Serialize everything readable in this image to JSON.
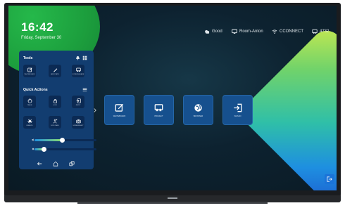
{
  "home": {
    "time": "16:42",
    "date": "Friday, September 30"
  },
  "status_bar": {
    "weather": "Good",
    "room": "Room-Anton",
    "connect": "CCONNECT",
    "code": "4732"
  },
  "sidebar": {
    "tools_title": "Tools",
    "tools": [
      {
        "label": "WHITEBOARD",
        "icon": "whiteboard-icon"
      },
      {
        "label": "ANNOTATE",
        "icon": "pen-icon"
      },
      {
        "label": "SCREENSHARE",
        "icon": "screenshare-icon"
      }
    ],
    "quick_title": "Quick Actions",
    "quick_actions": [
      {
        "label": "TIMER",
        "icon": "timer-icon"
      },
      {
        "label": "LOCK",
        "icon": "lock-icon"
      },
      {
        "label": "INPUT",
        "icon": "input-icon"
      },
      {
        "label": "FREEZE",
        "icon": "freeze-icon"
      },
      {
        "label": "EYE CARE",
        "icon": "eye-care-icon"
      },
      {
        "label": "SCREENSHOT",
        "icon": "camera-icon"
      }
    ],
    "volume_level": 0.45,
    "brightness_level": 0.15
  },
  "apps": [
    {
      "label": "WHITEBOARD",
      "icon": "whiteboard-icon"
    },
    {
      "label": "PROJECT",
      "icon": "project-icon"
    },
    {
      "label": "BROWSER",
      "icon": "globe-icon"
    },
    {
      "label": "SIGN-IN",
      "icon": "sign-in-icon"
    }
  ],
  "colors": {
    "panel": "#123d70",
    "tile": "#0b2a54",
    "app_tile": "#16508e",
    "accent_green": "#1c9e3d",
    "exit_button": "#1b73d8"
  }
}
